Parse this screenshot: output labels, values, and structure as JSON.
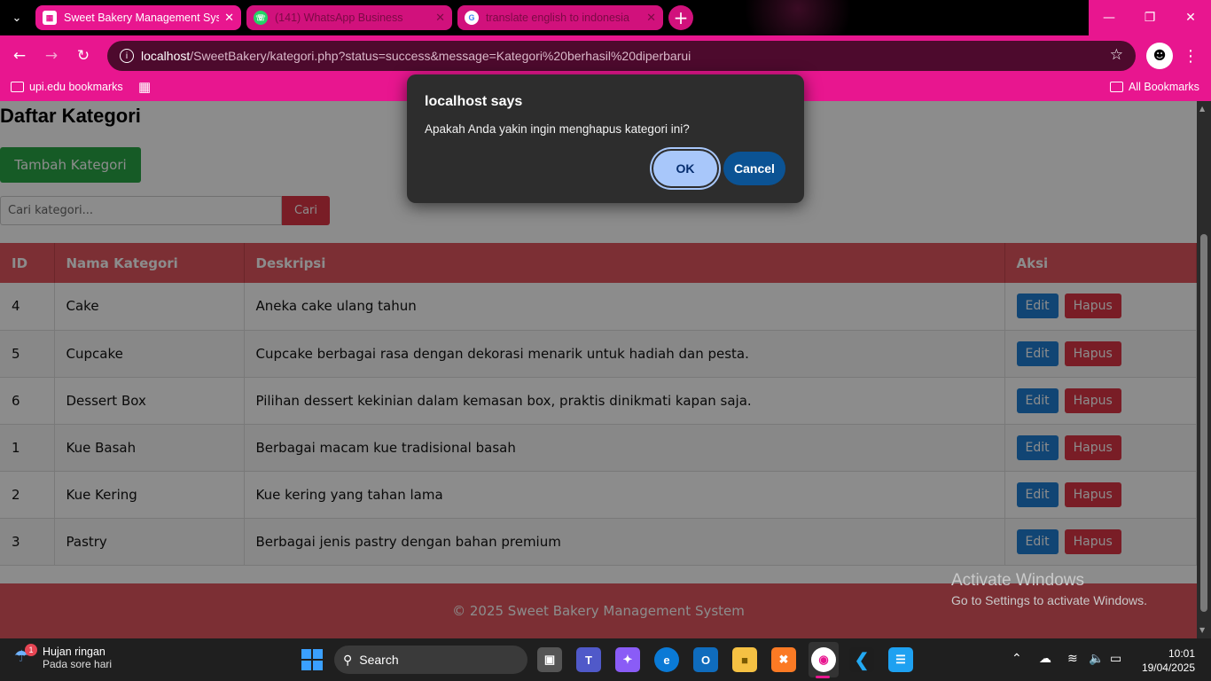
{
  "browser": {
    "tabs": [
      {
        "title": "Sweet Bakery Management Syst",
        "active": true
      },
      {
        "title": "(141) WhatsApp Business",
        "active": false
      },
      {
        "title": "translate english to indonesia",
        "active": false
      }
    ],
    "url_host": "localhost",
    "url_path": "/SweetBakery/kategori.php?status=success&message=Kategori%20berhasil%20diperbarui",
    "bookmarks": {
      "left": "upi.edu bookmarks",
      "right": "All Bookmarks"
    }
  },
  "page": {
    "title": "Daftar Kategori",
    "add_button": "Tambah Kategori",
    "search": {
      "placeholder": "Cari kategori...",
      "button": "Cari"
    },
    "table": {
      "headers": {
        "id": "ID",
        "name": "Nama Kategori",
        "desc": "Deskripsi",
        "action": "Aksi"
      },
      "rows": [
        {
          "id": "4",
          "name": "Cake",
          "desc": "Aneka cake ulang tahun"
        },
        {
          "id": "5",
          "name": "Cupcake",
          "desc": "Cupcake berbagai rasa dengan dekorasi menarik untuk hadiah dan pesta."
        },
        {
          "id": "6",
          "name": "Dessert Box",
          "desc": "Pilihan dessert kekinian dalam kemasan box, praktis dinikmati kapan saja."
        },
        {
          "id": "1",
          "name": "Kue Basah",
          "desc": "Berbagai macam kue tradisional basah"
        },
        {
          "id": "2",
          "name": "Kue Kering",
          "desc": "Kue kering yang tahan lama"
        },
        {
          "id": "3",
          "name": "Pastry",
          "desc": "Berbagai jenis pastry dengan bahan premium"
        }
      ],
      "edit_label": "Edit",
      "delete_label": "Hapus"
    },
    "footer": "© 2025 Sweet Bakery Management System"
  },
  "dialog": {
    "title": "localhost says",
    "message": "Apakah Anda yakin ingin menghapus kategori ini?",
    "ok": "OK",
    "cancel": "Cancel"
  },
  "watermark": {
    "line1": "Activate Windows",
    "line2": "Go to Settings to activate Windows."
  },
  "taskbar": {
    "weather_title": "Hujan ringan",
    "weather_sub": "Pada sore hari",
    "weather_badge": "1",
    "search_label": "Search",
    "time": "10:01",
    "date": "19/04/2025"
  },
  "colors": {
    "chrome_accent": "#e8168f",
    "table_header": "#e2575f",
    "add_button": "#28a745",
    "delete_button": "#dc3545",
    "edit_button": "#1f7fd4",
    "dialog_ok": "#a8c7fa",
    "dialog_cancel": "#0b5394"
  }
}
